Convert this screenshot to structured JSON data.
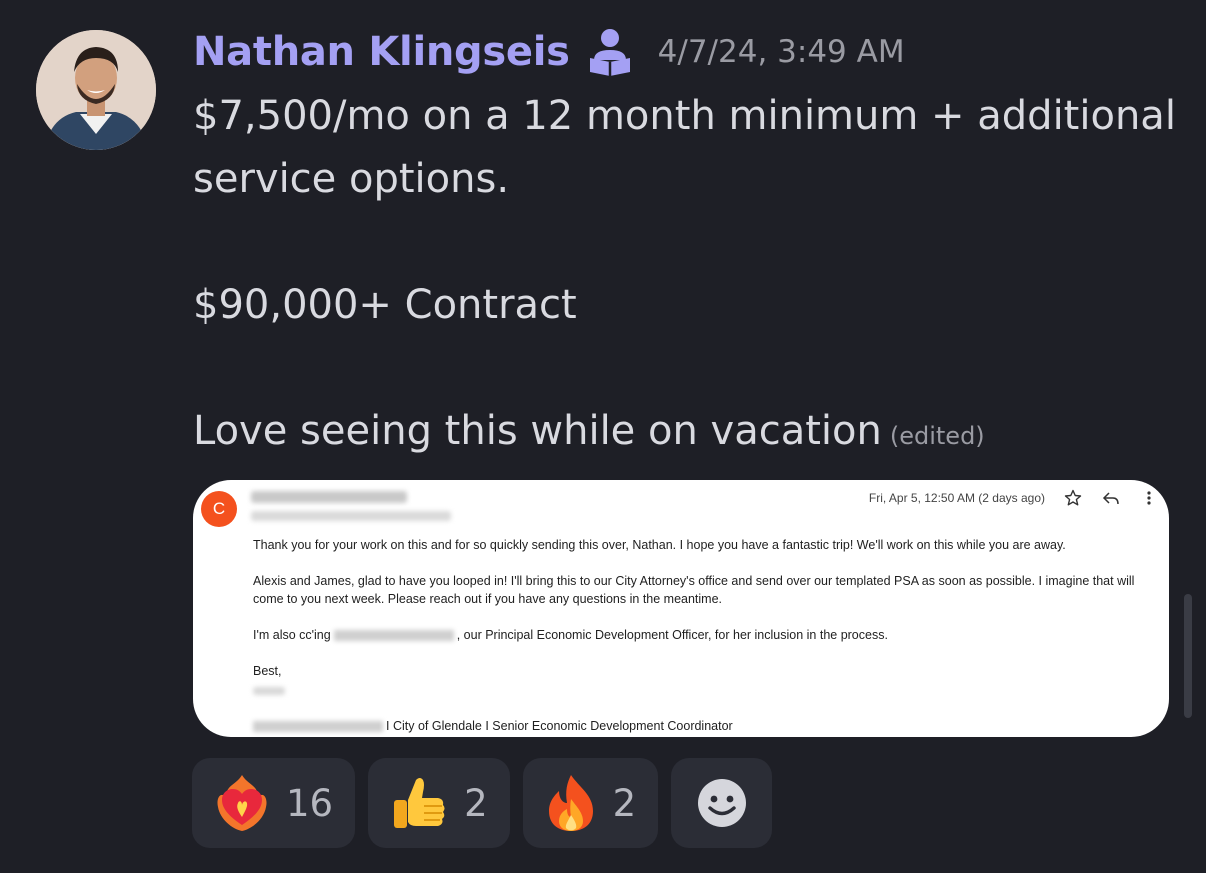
{
  "message": {
    "author": "Nathan Klingseis",
    "timestamp": "4/7/24, 3:49 AM",
    "lines": [
      "$7,500/mo on a 12 month minimum + additional service options.",
      "$90,000+ Contract",
      "Love seeing this while on vacation"
    ],
    "edited_label": "(edited)",
    "role_icon": "reader-person-icon"
  },
  "email_attachment": {
    "sender_initial": "C",
    "date": "Fri, Apr 5, 12:50 AM (2 days ago)",
    "paragraphs": [
      "Thank you for your work on this and for so quickly sending this over, Nathan. I hope you have a fantastic trip! We'll work on this while you are away.",
      "Alexis and James, glad to have you looped in! I'll bring this to our City Attorney's office and send over our templated PSA as soon as possible. I imagine that will come to you next week. Please reach out if you have any questions in the meantime."
    ],
    "cc_prefix": "I'm also cc'ing",
    "cc_suffix": ", our Principal Economic Development Officer, for her inclusion in the process.",
    "closing": "Best,",
    "signature": "I City of Glendale I Senior Economic Development Coordinator",
    "accent_color": "#f4511e"
  },
  "reactions": [
    {
      "icon": "heart-on-fire-icon",
      "count": "16"
    },
    {
      "icon": "thumbs-up-icon",
      "count": "2"
    },
    {
      "icon": "fire-icon",
      "count": "2"
    }
  ],
  "colors": {
    "background": "#1e1f26",
    "username": "#a4a0f3",
    "reaction_bg": "#2b2d36"
  }
}
